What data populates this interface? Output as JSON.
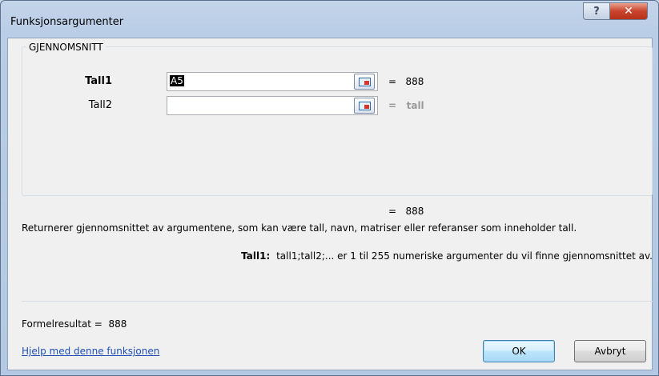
{
  "window": {
    "title": "Funksjonsargumenter",
    "help_label": "?",
    "close_label": "✕"
  },
  "function": {
    "name": "GJENNOMSNITT",
    "args": [
      {
        "label": "Tall1",
        "value": "A5",
        "result": "888"
      },
      {
        "label": "Tall2",
        "value": "",
        "result": "tall"
      }
    ],
    "eq_sign": "=",
    "overall_result": "888",
    "description": "Returnerer gjennomsnittet av argumentene, som kan være tall, navn, matriser eller referanser som inneholder tall.",
    "arg_help_name": "Tall1:",
    "arg_help_text": "tall1;tall2;... er 1 til 255 numeriske argumenter du vil finne gjennomsnittet av."
  },
  "footer": {
    "formula_result_label": "Formelresultat =",
    "formula_result_value": "888",
    "help_link": "Hjelp med denne funksjonen",
    "ok_label": "OK",
    "cancel_label": "Avbryt"
  },
  "icons": {
    "ref_button": "collapse-dialog-icon"
  }
}
